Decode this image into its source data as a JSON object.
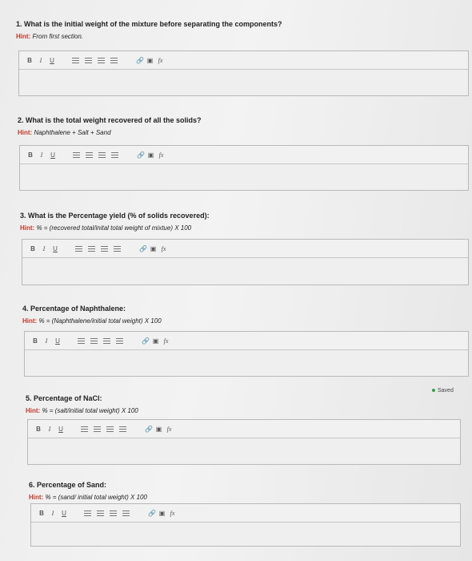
{
  "questions": [
    {
      "title": "1. What is the initial weight of the mixture before separating the components?",
      "hint_label": "Hint:",
      "hint_text": "From first section."
    },
    {
      "title": "2. What is the total weight recovered of all the solids?",
      "hint_label": "Hint:",
      "hint_text": "Naphthalene + Salt + Sand"
    },
    {
      "title": "3. What is the Percentage yield (% of solids recovered):",
      "hint_label": "Hint:",
      "hint_text": "% = (recovered total/inital total weight of mixtue) X 100"
    },
    {
      "title": "4. Percentage of Naphthalene:",
      "hint_label": "Hint:",
      "hint_text": "% = (Naphthalene/initial total weight) X 100"
    },
    {
      "title": "5. Percentage of NaCl:",
      "hint_label": "Hint:",
      "hint_text": "% = (salt/initial total weight) X 100"
    },
    {
      "title": "6. Percentage of Sand:",
      "hint_label": "Hint:",
      "hint_text": "% = (sand/ initial total weight) X 100"
    }
  ],
  "toolbar": {
    "bold": "B",
    "italic": "I",
    "underline": "U",
    "link_icon": "🔗",
    "image_icon": "▣",
    "fx": "fx"
  },
  "status": {
    "saved": "Saved",
    "saved_color": "#3c9a4a"
  },
  "colors": {
    "hint": "#c0392b"
  }
}
